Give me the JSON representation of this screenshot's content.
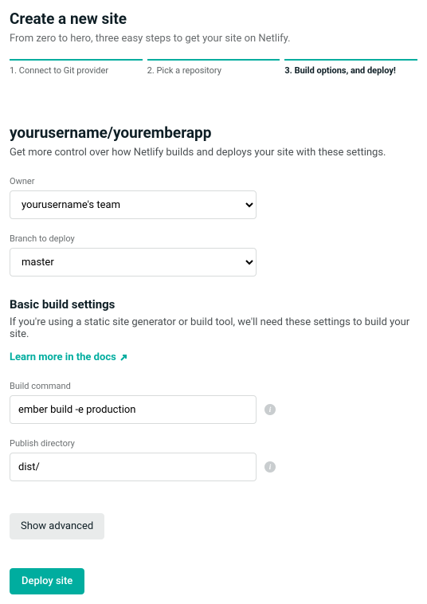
{
  "header": {
    "title": "Create a new site",
    "subtitle": "From zero to hero, three easy steps to get your site on Netlify."
  },
  "steps": [
    {
      "label": "1. Connect to Git provider"
    },
    {
      "label": "2. Pick a repository"
    },
    {
      "label": "3. Build options, and deploy!"
    }
  ],
  "repo": {
    "title": "yourusername/youremberapp",
    "subtitle": "Get more control over how Netlify builds and deploys your site with these settings."
  },
  "owner": {
    "label": "Owner",
    "value": "yourusername's team"
  },
  "branch": {
    "label": "Branch to deploy",
    "value": "master"
  },
  "build_settings": {
    "title": "Basic build settings",
    "description": "If you're using a static site generator or build tool, we'll need these settings to build your site.",
    "docs_link": "Learn more in the docs"
  },
  "build_command": {
    "label": "Build command",
    "value": "ember build -e production"
  },
  "publish_dir": {
    "label": "Publish directory",
    "value": "dist/"
  },
  "buttons": {
    "show_advanced": "Show advanced",
    "deploy": "Deploy site"
  }
}
